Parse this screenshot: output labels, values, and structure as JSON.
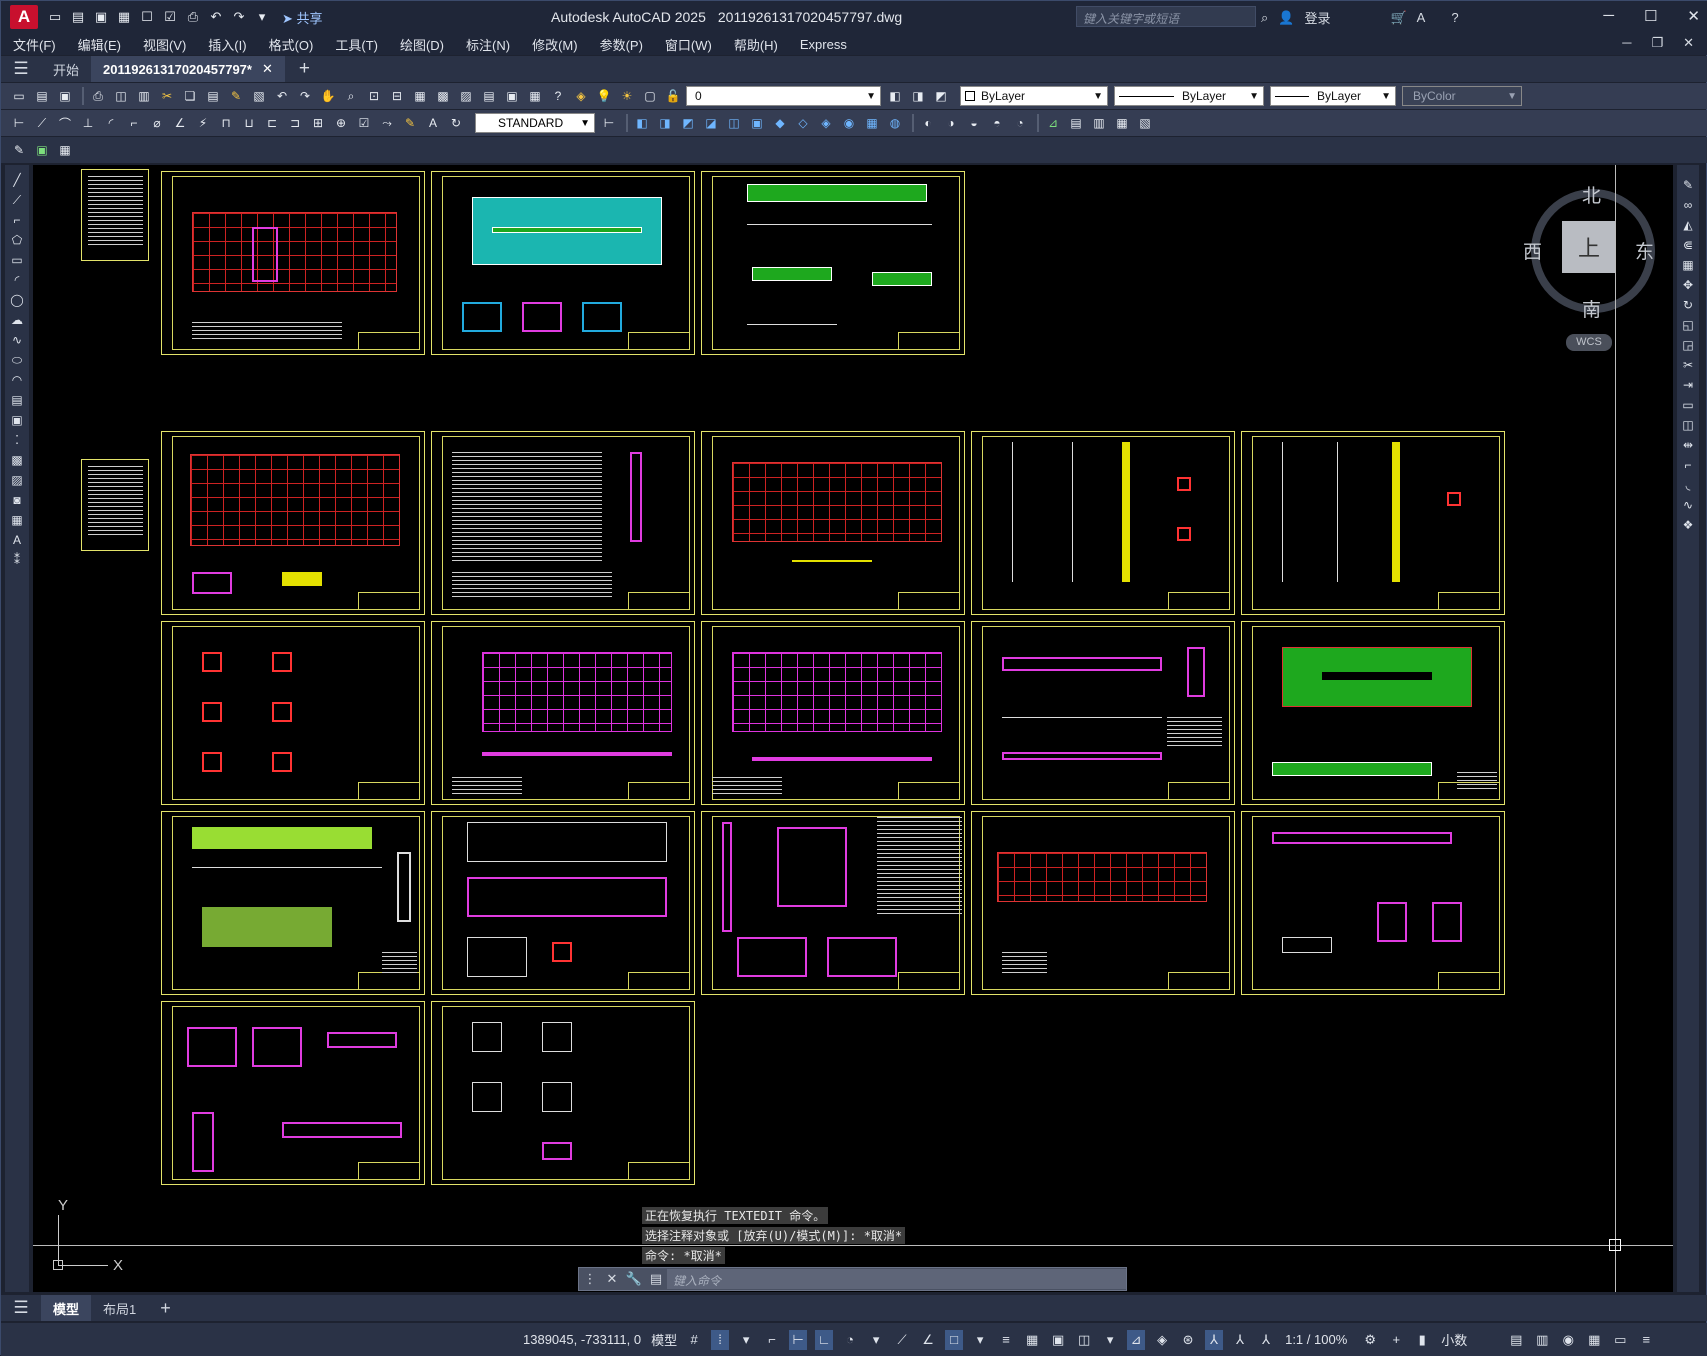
{
  "app": {
    "name": "Autodesk AutoCAD 2025",
    "file": "20119261317020457797.dwg",
    "share": "共享",
    "search_placeholder": "键入关键字或短语",
    "login": "登录"
  },
  "menu": [
    "文件(F)",
    "编辑(E)",
    "视图(V)",
    "插入(I)",
    "格式(O)",
    "工具(T)",
    "绘图(D)",
    "标注(N)",
    "修改(M)",
    "参数(P)",
    "窗口(W)",
    "帮助(H)",
    "Express"
  ],
  "tabs": {
    "start": "开始",
    "doc": "20119261317020457797*"
  },
  "toolbar": {
    "layer": "0",
    "color": "ByLayer",
    "linetype": "ByLayer",
    "lineweight": "ByLayer",
    "plotstyle": "ByColor",
    "textstyle": "STANDARD"
  },
  "viewcube": {
    "n": "北",
    "s": "南",
    "e": "东",
    "w": "西",
    "top": "上",
    "wcs": "WCS"
  },
  "axis": {
    "y": "Y",
    "x": "X"
  },
  "command": {
    "line1": "正在恢复执行 TEXTEDIT 命令。",
    "line2": "选择注释对象或 [放弃(U)/模式(M)]: *取消*",
    "line3": "命令: *取消*",
    "placeholder": "键入命令"
  },
  "layouts": {
    "model": "模型",
    "layout1": "布局1"
  },
  "status": {
    "coords": "1389045, -733111, 0",
    "mode": "模型",
    "scale": "1:1 / 100%",
    "units": "小数"
  }
}
